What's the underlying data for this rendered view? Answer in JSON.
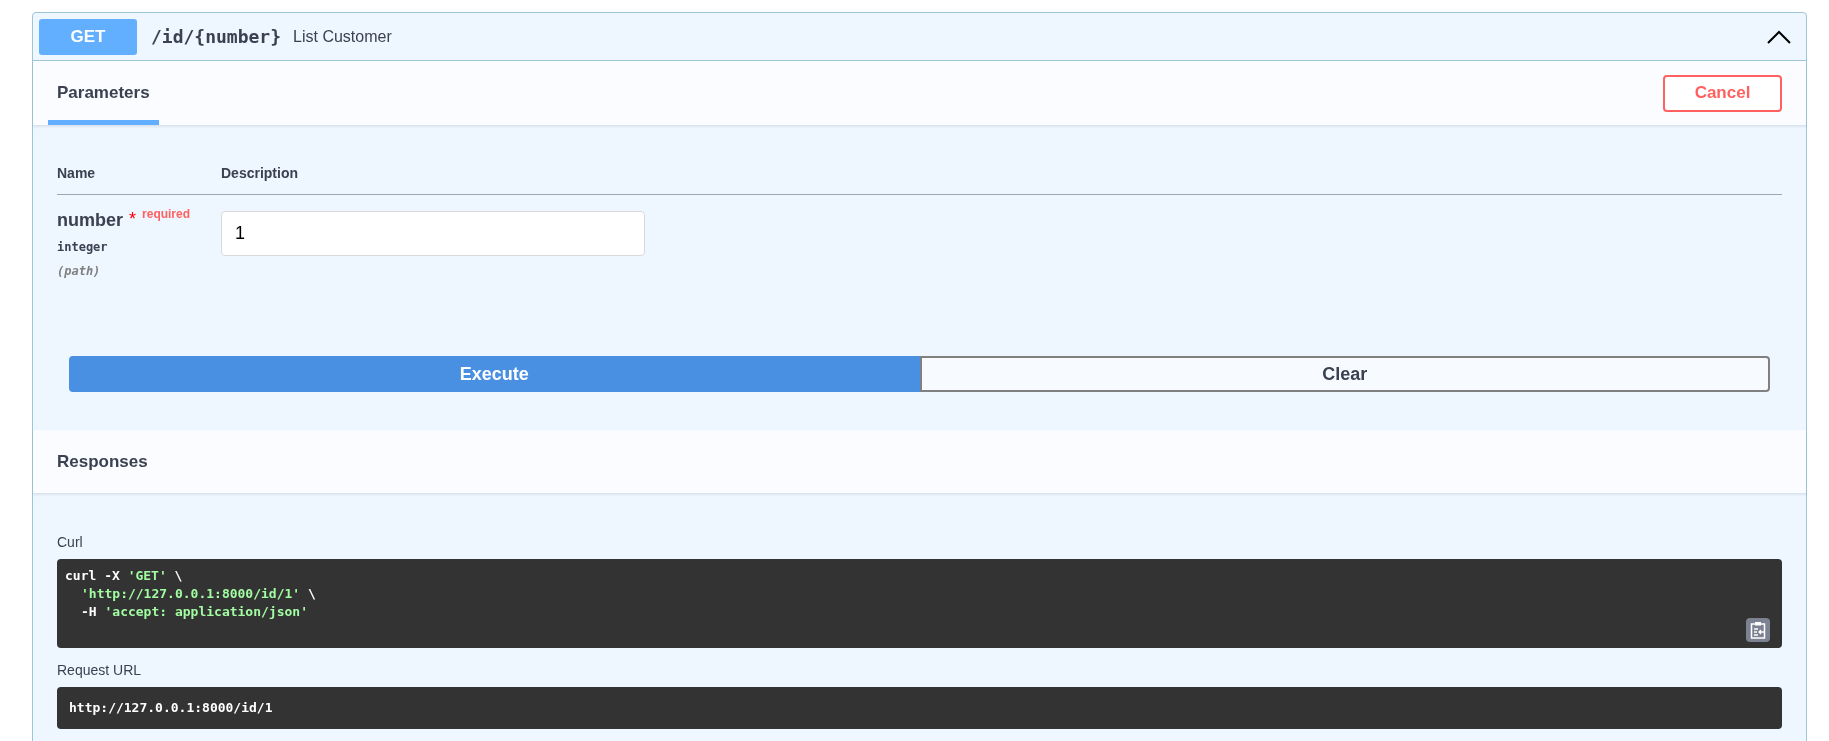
{
  "operation": {
    "method": "GET",
    "path": "/id/{number}",
    "summary": "List Customer",
    "expanded": true
  },
  "tabs": [
    {
      "label": "Parameters",
      "selected": true
    }
  ],
  "cancel_button": "Cancel",
  "parameters": {
    "columns": [
      "Name",
      "Description"
    ],
    "rows": [
      {
        "name": "number",
        "required_mark": "*",
        "required_label": "required",
        "type": "integer",
        "location": "(path)",
        "value": "1"
      }
    ]
  },
  "buttons": [
    {
      "label": "Execute",
      "kind": "primary"
    },
    {
      "label": "Clear",
      "kind": "secondary"
    }
  ],
  "responses": {
    "title": "Responses",
    "curl": {
      "label": "Curl",
      "lines": [
        {
          "indented": false,
          "parts": [
            {
              "kind": "plain",
              "text": "curl -X "
            },
            {
              "kind": "string",
              "text": "'GET'"
            },
            {
              "kind": "plain",
              "text": " \\"
            }
          ]
        },
        {
          "indented": true,
          "parts": [
            {
              "kind": "string",
              "text": "'http://127.0.0.1:8000/id/1'"
            },
            {
              "kind": "plain",
              "text": " \\"
            }
          ]
        },
        {
          "indented": true,
          "parts": [
            {
              "kind": "plain",
              "text": "-H "
            },
            {
              "kind": "string",
              "text": "'accept: application/json'"
            }
          ]
        }
      ]
    },
    "request_url": {
      "label": "Request URL",
      "value": "http://127.0.0.1:8000/id/1"
    }
  }
}
